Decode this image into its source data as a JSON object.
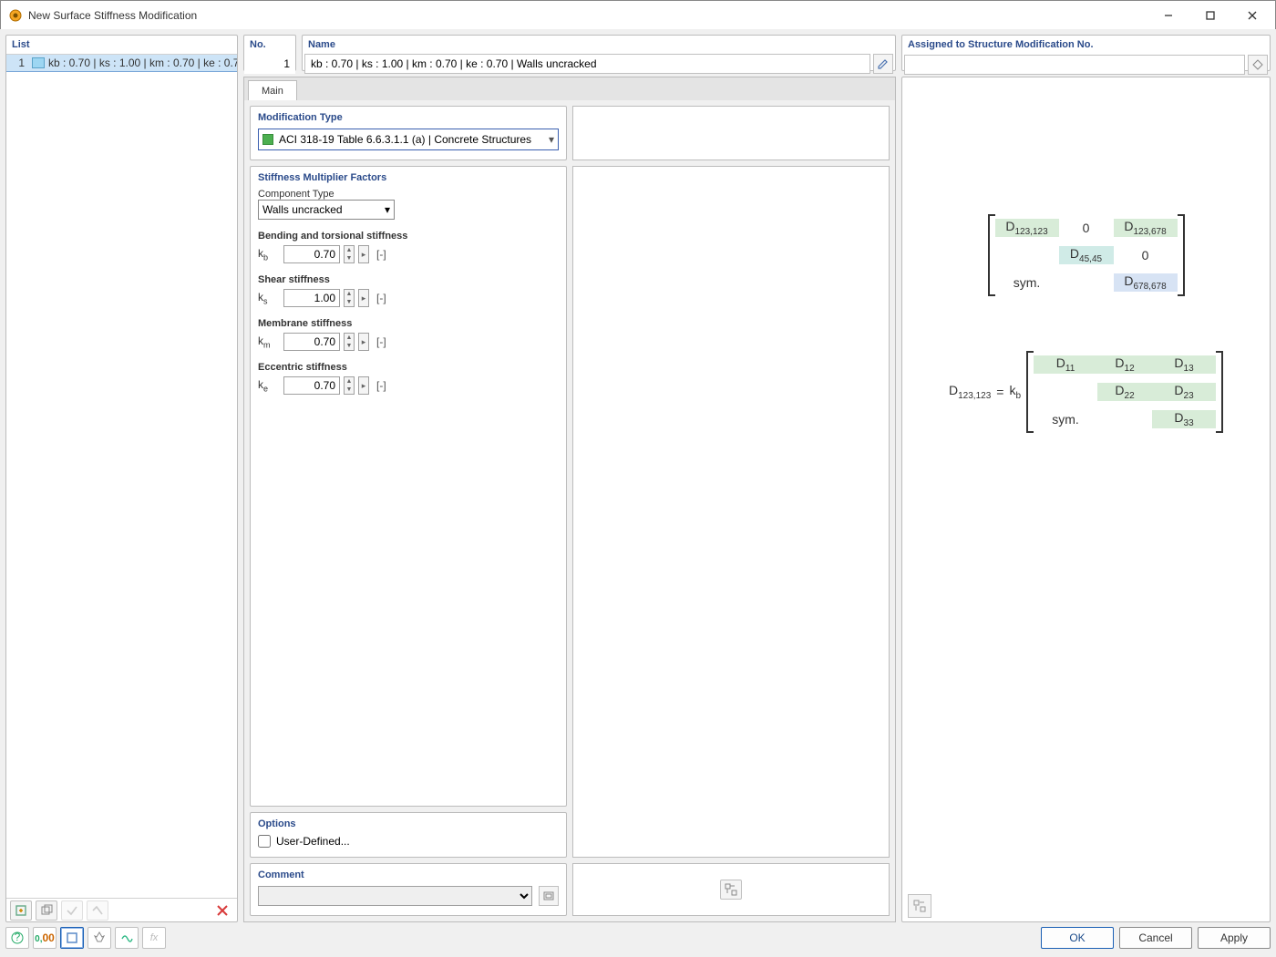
{
  "window": {
    "title": "New Surface Stiffness Modification"
  },
  "list": {
    "header": "List",
    "items": [
      {
        "num": "1",
        "text": "kb : 0.70 | ks : 1.00 | km : 0.70 | ke : 0.70 | Walls uncracked"
      }
    ]
  },
  "no": {
    "header": "No.",
    "value": "1"
  },
  "name": {
    "header": "Name",
    "value": "kb : 0.70 | ks : 1.00 | km : 0.70 | ke : 0.70 | Walls uncracked"
  },
  "assigned": {
    "header": "Assigned to Structure Modification No.",
    "value": ""
  },
  "tabs": {
    "main": "Main"
  },
  "mod_type": {
    "title": "Modification Type",
    "value": "ACI 318-19 Table 6.6.3.1.1 (a) | Concrete Structures"
  },
  "factors": {
    "title": "Stiffness Multiplier Factors",
    "component_label": "Component Type",
    "component_value": "Walls uncracked",
    "bending": {
      "label": "Bending and torsional stiffness",
      "sym": "k",
      "sub": "b",
      "val": "0.70",
      "unit": "[-]"
    },
    "shear": {
      "label": "Shear stiffness",
      "sym": "k",
      "sub": "s",
      "val": "1.00",
      "unit": "[-]"
    },
    "membrane": {
      "label": "Membrane stiffness",
      "sym": "k",
      "sub": "m",
      "val": "0.70",
      "unit": "[-]"
    },
    "eccentric": {
      "label": "Eccentric stiffness",
      "sym": "k",
      "sub": "e",
      "val": "0.70",
      "unit": "[-]"
    }
  },
  "options": {
    "title": "Options",
    "user_defined": "User-Defined..."
  },
  "comment": {
    "title": "Comment"
  },
  "buttons": {
    "ok": "OK",
    "cancel": "Cancel",
    "apply": "Apply"
  },
  "matrix": {
    "m1": {
      "r1": [
        "D123,123",
        "0",
        "D123,678"
      ],
      "r2": [
        "",
        "D45,45",
        "0"
      ],
      "r3": [
        "sym.",
        "",
        "D678,678"
      ]
    },
    "lhs": "D123,123",
    "eq": "=",
    "factor": "kb",
    "m2": {
      "r1": [
        "D11",
        "D12",
        "D13"
      ],
      "r2": [
        "",
        "D22",
        "D23"
      ],
      "r3": [
        "sym.",
        "",
        "D33"
      ]
    }
  }
}
